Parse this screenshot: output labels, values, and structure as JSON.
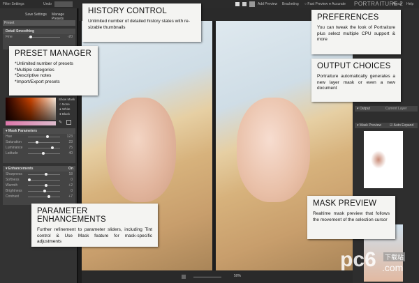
{
  "topbar": {
    "filter_settings": "Filter Settings",
    "undo": "Undo",
    "add_preview": "Add Preview",
    "bracketing": "Bracketing",
    "fast_preview": "Fast Preview",
    "accurate": "Accurate",
    "brand": "PORTRAITURE 2",
    "about": "About",
    "help": "Help"
  },
  "left": {
    "save_settings": "Save Settings",
    "manage_presets": "Manage Presets",
    "preset": "Preset",
    "detail_smoothing": "Detail Smoothing",
    "fine": {
      "label": "Fine",
      "value": "-20"
    },
    "show_mask": "Show Mask",
    "mask_options": [
      "None",
      "White",
      "Black"
    ],
    "mask_parameters": {
      "title": "Mask Parameters",
      "rows": [
        {
          "label": "Hue",
          "value": "123",
          "pos": 0.6
        },
        {
          "label": "Saturation",
          "value": "23",
          "pos": 0.25
        },
        {
          "label": "Luminance",
          "value": "75",
          "pos": 0.75
        },
        {
          "label": "Latitude",
          "value": "40",
          "pos": 0.45
        }
      ]
    },
    "enhancements": {
      "title": "Enhancements",
      "toggle": "On",
      "rows": [
        {
          "label": "Sharpness",
          "value": "18",
          "pos": 0.55
        },
        {
          "label": "Softness",
          "value": "0",
          "pos": 0.0
        },
        {
          "label": "Warmth",
          "value": "+2",
          "pos": 0.55
        },
        {
          "label": "Brightness",
          "value": "0",
          "pos": 0.5
        },
        {
          "label": "Contrast",
          "value": "+7",
          "pos": 0.65
        }
      ]
    }
  },
  "right": {
    "output": "Output",
    "current_layer": "Current Layer",
    "mask_preview": "Mask Preview",
    "auto_expand": "Auto Expand"
  },
  "bottom": {
    "zoom": "50%"
  },
  "callouts": {
    "history": {
      "title": "HISTORY CONTROL",
      "text": "Unlimited number of detailed history states with re-sizable thumbnails"
    },
    "preferences": {
      "title": "PREFERENCES",
      "text": "You can tweak the look of Portraiture plus select multiple CPU support & more"
    },
    "output": {
      "title": "OUTPUT CHOICES",
      "text": "Portraiture automatically generates a new layer mask or even a new document"
    },
    "preset": {
      "title": "PRESET MANAGER",
      "lines": [
        "*Unlimited number of presets",
        "*Multiple categories",
        "*Descriptive notes",
        "*Import/Export presets"
      ]
    },
    "parameter": {
      "title": "PARAMETER ENHANCEMENTS",
      "text": "Further refinement to parameter sliders, including Tint control & Use Mask feature for mask-specific adjustments"
    },
    "mask": {
      "title": "MASK PREVIEW",
      "text": "Realtime mask preview that follows the movement of the selection cursor"
    }
  },
  "watermark": {
    "logo": "pc6",
    "cn": "下载站",
    "com": ".com"
  }
}
